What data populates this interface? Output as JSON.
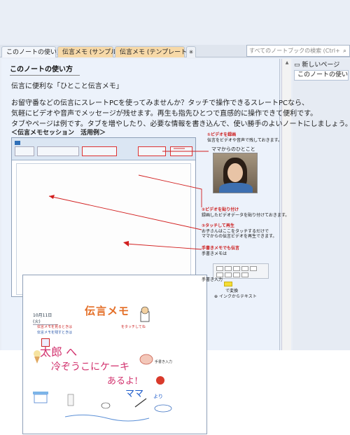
{
  "tabs": [
    {
      "label": "このノートの使い方"
    },
    {
      "label": "伝言メモ (サンプル)"
    },
    {
      "label": "伝言メモ (テンプレート)"
    }
  ],
  "search": {
    "placeholder": "すべてのノートブックの検索 (Ctrl+E)"
  },
  "sidebar": {
    "new_page": "新しいページ",
    "pages": [
      "このノートの使い方"
    ]
  },
  "page": {
    "title": "このノートの使い方",
    "intro": "伝言に便利な「ひとこと伝言メモ」",
    "body_lines": [
      "お留守番などの伝言にスレートPCを使ってみませんか？タッチで操作できるスレートPCなら、",
      "気軽にビデオや音声でメッセージが残せます。再生も指先ひとつで直感的に操作できて便利です。",
      "タブやページは例です。タブを増やしたり、必要な情報を書き込んで、使い勝手のよいノートにしましょう。"
    ],
    "example_heading": "＜伝言メモセッション　活用例＞"
  },
  "screenshot": {
    "date": "10月11日 (火)",
    "heading": "伝言メモ",
    "hw_line1": "太郎 へ",
    "hw_line2": "冷ぞうこにケーキ",
    "hw_line3": "あるよ!",
    "hw_sign": "ママ",
    "hw_sign2": "より",
    "red_note1": "伝言メモを見るときは",
    "red_note2": "をタッチしてね",
    "blue_note": "伝言メモを残すときは",
    "label_small": "手書き入力"
  },
  "annotations": {
    "a1_title": "①ビデオを録画",
    "a1_desc": "伝言をビデオや音声で残しておきます。",
    "a1_caption": "ママからのひとこと",
    "a2_title": "②ビデオを貼り付け",
    "a2_desc": "録画したビデオデータを貼り付けておきます。",
    "a3_title": "③タッチして再生",
    "a3_desc1": "お子さんはここをタッチするだけで",
    "a3_desc2": "ママからの伝言ビデオを再生できます。",
    "a4_title": "手書きメモでも伝言",
    "a4_desc": "手書きメモは",
    "a4_label": "手書き入力",
    "a4_change": "で変換",
    "ink_button": "インクからテキスト"
  },
  "colors": {
    "accent_red": "#cc1e1e",
    "tab_orange": "#f7d9a8",
    "heading_orange": "#e46e26"
  }
}
